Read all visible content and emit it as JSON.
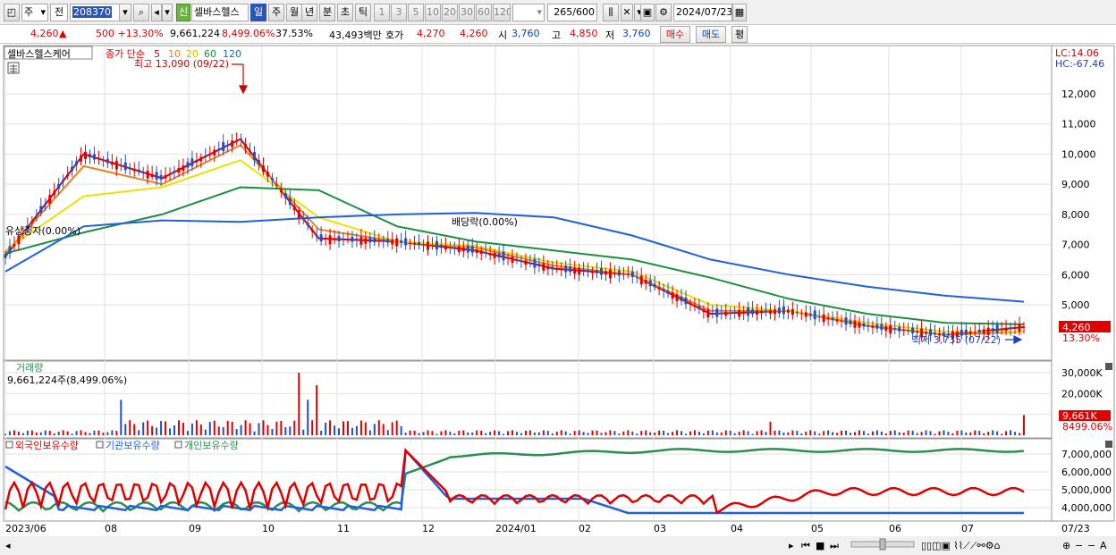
{
  "toolbar": {
    "period_select": "주",
    "prev_label": "전",
    "stock_code": "208370",
    "new_label": "신",
    "stock_name": "셀바스헬스",
    "tabs": [
      "일",
      "주",
      "월",
      "년",
      "분",
      "초",
      "틱"
    ],
    "active_tab": "일",
    "intervals": [
      "1",
      "3",
      "5",
      "10",
      "20",
      "30",
      "60",
      "120"
    ],
    "count_display": "265",
    "count_total": "/600",
    "date": "2024/07/23"
  },
  "quote": {
    "price": "4,260",
    "change": "500 +13.30%",
    "volume": "9,661,224",
    "volume_ratio": "8,499.06%",
    "turnover": "37.53%",
    "amount": "43,493백만",
    "bid_label": "호가",
    "ask_price": "4,270",
    "bid_price": "4,260",
    "open_label": "시",
    "open": "3,760",
    "high_label": "고",
    "high": "4,850",
    "low_label": "저",
    "low": "3,760",
    "buy_label": "매수",
    "sell_label": "매도",
    "avg_label": "평"
  },
  "price_panel": {
    "name_box": "셀바스헬스케어",
    "ma_title": "종가 단순",
    "ma_periods": [
      "5",
      "10",
      "20",
      "60",
      "120"
    ],
    "lc": "LC:14.06",
    "hc": "HC:-67.46",
    "high_annotation": "최고 13,090 (09/22)",
    "low_annotation": "최저 3,735 (07/22)",
    "event_rights": "유상증자(0.00%)",
    "event_dividend": "배당락(0.00%)",
    "y_ticks": [
      "12,000",
      "11,000",
      "10,000",
      "9,000",
      "8,000",
      "7,000",
      "6,000",
      "5,000"
    ],
    "last_price": "4,260",
    "last_change": "13.30%"
  },
  "volume_panel": {
    "title": "거래량",
    "summary": "9,661,224주(8,499.06%)",
    "y_ticks": [
      "30,000K",
      "20,000K",
      "10,000K"
    ],
    "last_value": "9,661K",
    "last_ratio": "8499.06%"
  },
  "holdings_panel": {
    "series_names": [
      "외국인보유수량",
      "기관보유수량",
      "개인보유수량"
    ],
    "y_ticks": [
      "7,000,000",
      "6,000,000",
      "5,000,000",
      "4,000,000"
    ]
  },
  "x_axis": [
    "2023/06",
    "08",
    "09",
    "10",
    "11",
    "12",
    "2024/01",
    "02",
    "03",
    "04",
    "05",
    "06",
    "07",
    "07/23"
  ],
  "colors": {
    "up": "#e00000",
    "down": "#1f50c8",
    "ma5": "#dc0000",
    "ma10": "#f08020",
    "ma20": "#f0e000",
    "ma60": "#1a9040",
    "ma120": "#2060e0",
    "foreign": "#e00000",
    "institution": "#2060e0",
    "individual": "#2a9050"
  },
  "chart_data": {
    "type": "line",
    "x": [
      "2023/06",
      "08",
      "09",
      "10",
      "11",
      "12",
      "2024/01",
      "02",
      "03",
      "04",
      "05",
      "06",
      "07",
      "07/23"
    ],
    "series": [
      {
        "name": "5",
        "values": [
          6600,
          10000,
          9200,
          10500,
          7200,
          7100,
          6800,
          6200,
          6000,
          4700,
          4800,
          4300,
          4000,
          4260
        ]
      },
      {
        "name": "10",
        "values": [
          6700,
          9600,
          9000,
          10300,
          7500,
          7100,
          6900,
          6300,
          6000,
          4800,
          4800,
          4300,
          4000,
          4100
        ]
      },
      {
        "name": "20",
        "values": [
          6800,
          8600,
          8900,
          9800,
          7900,
          7100,
          6950,
          6400,
          6100,
          5000,
          4800,
          4400,
          4100,
          4100
        ]
      },
      {
        "name": "60",
        "values": [
          6700,
          7400,
          8000,
          8900,
          8800,
          7600,
          7100,
          6800,
          6500,
          5900,
          5200,
          4700,
          4400,
          4350
        ]
      },
      {
        "name": "120",
        "values": [
          6100,
          7600,
          7800,
          7750,
          7900,
          8000,
          8050,
          7900,
          7300,
          6500,
          6000,
          5600,
          5300,
          5100
        ]
      }
    ],
    "ylim": [
      3500,
      14000
    ]
  }
}
